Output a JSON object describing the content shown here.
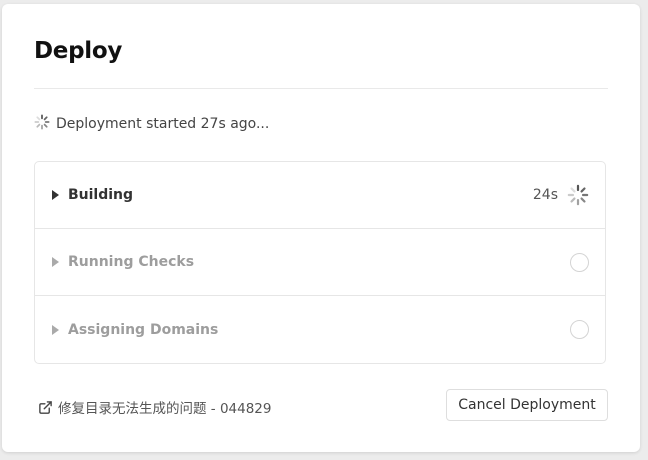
{
  "deploy": {
    "title": "Deploy",
    "status_text": "Deployment started 27s ago...",
    "steps": [
      {
        "label": "Building",
        "state": "running",
        "duration": "24s"
      },
      {
        "label": "Running Checks",
        "state": "pending"
      },
      {
        "label": "Assigning Domains",
        "state": "pending"
      }
    ],
    "commit_link": "修复目录无法生成的问题 - 044829",
    "cancel_label": "Cancel Deployment"
  },
  "icons": {
    "status_spinner": "spinner-icon",
    "step_toggle": "caret-right-icon",
    "pending": "circle-icon",
    "link": "external-link-icon"
  },
  "colors": {
    "background": "#ececec",
    "card": "#ffffff",
    "text_active": "#333333",
    "text_dim": "#9d9d9d",
    "border": "#e6e6e6"
  }
}
